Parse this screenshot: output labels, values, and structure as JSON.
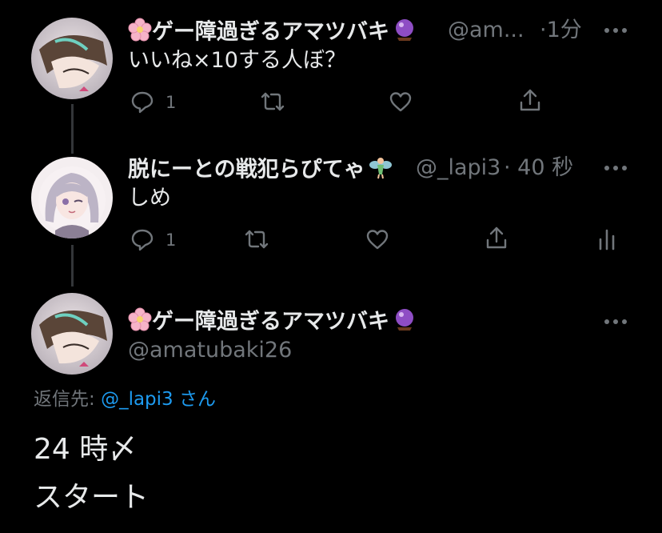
{
  "tweets": [
    {
      "name": "ゲー障過ぎるアマツバキ",
      "handle": "@am...",
      "time": "·1分",
      "text": "いいね×10する人ぼ？",
      "reply_count": "1"
    },
    {
      "name": "脱にーとの戦犯らぴてゃ",
      "handle": "@_lapi3",
      "time": "· 40 秒",
      "text": "しめ",
      "reply_count": "1"
    }
  ],
  "main_tweet": {
    "name": "ゲー障過ぎるアマツバキ",
    "handle": "@amatubaki26",
    "reply_label": "返信先:",
    "reply_to": "@_lapi3 さん",
    "text_line1": "24 時〆",
    "text_line2": "スタート"
  },
  "colors": {
    "background": "#000000",
    "primary_text": "#e7e9ea",
    "secondary_text": "#71767b",
    "link": "#1d9bf0",
    "thread_line": "#333639"
  },
  "icons": [
    "cherry-blossom-icon",
    "crystal-ball-icon",
    "fairy-icon",
    "reply-icon",
    "retweet-icon",
    "like-icon",
    "share-icon",
    "analytics-icon",
    "more-icon"
  ]
}
